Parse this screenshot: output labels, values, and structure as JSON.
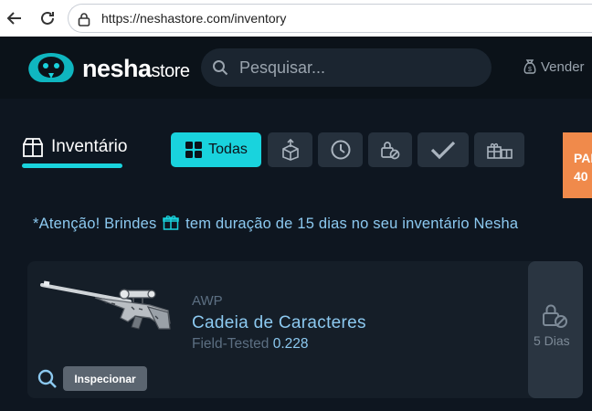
{
  "browser": {
    "url": "https://neshastore.com/inventory"
  },
  "header": {
    "logo_main": "nesha",
    "logo_sub": "store",
    "search_placeholder": "Pesquisar...",
    "sell_label": "Vender"
  },
  "inventory": {
    "title": "Inventário",
    "filters": [
      {
        "label": "Todas",
        "icon": "grid-icon",
        "active": true
      },
      {
        "label": "",
        "icon": "box-upload-icon",
        "active": false
      },
      {
        "label": "",
        "icon": "clock-icon",
        "active": false
      },
      {
        "label": "",
        "icon": "lock-blocked-icon",
        "active": false
      },
      {
        "label": "",
        "icon": "check-icon",
        "active": false
      },
      {
        "label": "",
        "icon": "gift-stack-icon",
        "active": false
      }
    ],
    "promo_line1": "PAR",
    "promo_line2": "40"
  },
  "notice": {
    "prefix": "*Atenção! Brindes",
    "suffix": "tem duração de 15 dias no seu inventário Nesha"
  },
  "item": {
    "type": "AWP",
    "name": "Cadeia de Caracteres",
    "wear": "Field-Tested",
    "float": "0.228",
    "inspect_label": "Inspecionar",
    "lock_days": "5 Dias"
  },
  "colors": {
    "accent": "#19d3dd",
    "background": "#0e1620",
    "card": "#151e28",
    "promo": "#f08a4b"
  }
}
